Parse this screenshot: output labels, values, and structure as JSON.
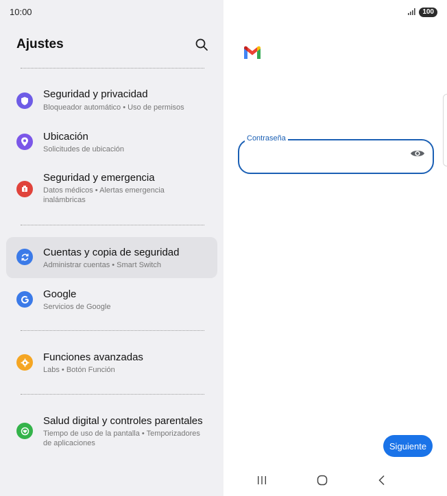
{
  "status_bar": {
    "time": "10:00",
    "signal_icon": "signal-icon",
    "battery": "100"
  },
  "settings": {
    "title": "Ajustes",
    "search_icon": "search-icon",
    "items": [
      {
        "title": "Seguridad y privacidad",
        "subtitle": "Bloqueador automático • Uso de permisos",
        "icon": "shield-icon",
        "color": "#6e5ce6"
      },
      {
        "title": "Ubicación",
        "subtitle": "Solicitudes de ubicación",
        "icon": "location-pin-icon",
        "color": "#7b57e8"
      },
      {
        "title": "Seguridad y emergencia",
        "subtitle": "Datos médicos • Alertas emergencia inalámbricas",
        "icon": "emergency-icon",
        "color": "#e0433b"
      },
      {
        "title": "Cuentas y copia de seguridad",
        "subtitle": "Administrar cuentas • Smart Switch",
        "icon": "sync-icon",
        "color": "#3b7ae8",
        "selected": true
      },
      {
        "title": "Google",
        "subtitle": "Servicios de Google",
        "icon": "google-icon",
        "color": "#3b7ae8"
      },
      {
        "title": "Funciones avanzadas",
        "subtitle": "Labs • Botón Función",
        "icon": "gear-plus-icon",
        "color": "#f5a623"
      },
      {
        "title": "Salud digital y controles parentales",
        "subtitle": "Tiempo de uso de la pantalla • Temporizadores de aplicaciones",
        "icon": "digital-wellbeing-icon",
        "color": "#34b34a"
      }
    ]
  },
  "signin": {
    "logo": "gmail-logo",
    "password_label": "Contraseña",
    "password_value": "",
    "toggle_icon": "eye-icon",
    "next_label": "Siguiente"
  },
  "navbar": {
    "recent_icon": "recent-apps-icon",
    "home_icon": "home-icon",
    "back_icon": "back-icon"
  },
  "colors": {
    "accent": "#1a73e8",
    "field_border": "#1a5fb4",
    "panel_bg": "#f0f0f3"
  }
}
